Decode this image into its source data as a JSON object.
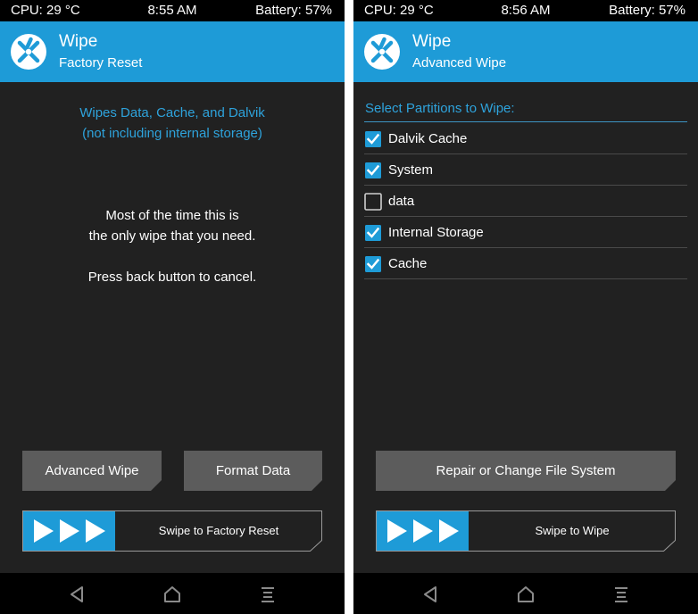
{
  "left": {
    "status": {
      "cpu": "CPU: 29 °C",
      "time": "8:55 AM",
      "battery": "Battery: 57%"
    },
    "header": {
      "title": "Wipe",
      "subtitle": "Factory Reset"
    },
    "info_blue": [
      "Wipes Data, Cache, and Dalvik",
      "(not including internal storage)"
    ],
    "info_white": [
      "Most of the time this is",
      "the only wipe that you need."
    ],
    "cancel_text": "Press back button to cancel.",
    "buttons": {
      "advanced": "Advanced Wipe",
      "format": "Format Data"
    },
    "swipe_label": "Swipe to Factory Reset"
  },
  "right": {
    "status": {
      "cpu": "CPU: 29 °C",
      "time": "8:56 AM",
      "battery": "Battery: 57%"
    },
    "header": {
      "title": "Wipe",
      "subtitle": "Advanced Wipe"
    },
    "select_title": "Select Partitions to Wipe:",
    "partitions": [
      {
        "label": "Dalvik Cache",
        "checked": true
      },
      {
        "label": "System",
        "checked": true
      },
      {
        "label": "data",
        "checked": false
      },
      {
        "label": "Internal Storage",
        "checked": true
      },
      {
        "label": "Cache",
        "checked": true
      }
    ],
    "repair_button": "Repair or Change File System",
    "swipe_label": "Swipe to Wipe"
  },
  "colors": {
    "accent": "#1e9bd7",
    "info_text": "#2ea3dc",
    "background": "#212121",
    "button": "#5c5c5c",
    "bars": "#000000"
  },
  "icons": {
    "logo": "twrp-logo-icon",
    "swipe_arrows": "triple-arrow-icon",
    "nav_back": "back-triangle-icon",
    "nav_home": "home-icon",
    "nav_menu": "menu-icon",
    "checkbox_on": "checkbox-checked-icon",
    "checkbox_off": "checkbox-unchecked-icon"
  }
}
